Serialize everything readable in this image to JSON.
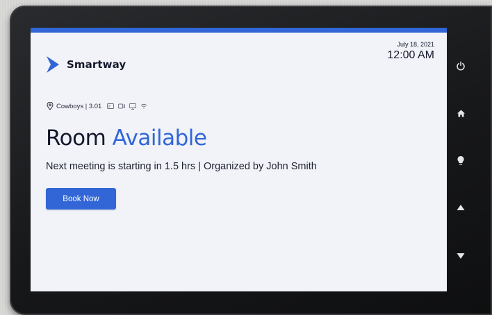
{
  "brand": {
    "name": "Smartway",
    "logo_icon": "chevron-right-icon",
    "accent": "#3266d6"
  },
  "header": {
    "date": "July 18, 2021",
    "time": "12:00 AM"
  },
  "room": {
    "location": "Cowboys | 3.01",
    "location_icon": "map-pin-icon",
    "amenities": [
      "id-card-icon",
      "video-camera-icon",
      "monitor-icon",
      "wifi-icon"
    ],
    "title_prefix": "Room",
    "title_status": "Available",
    "next_meeting": "Next meeting is starting in 1.5 hrs | Organized by John Smith",
    "book_label": "Book Now"
  },
  "device_buttons": [
    "power-icon",
    "home-icon",
    "lightbulb-icon",
    "arrow-up-icon",
    "arrow-down-icon"
  ],
  "colors": {
    "primary": "#3266d6",
    "text": "#14172a",
    "screen_bg": "#f1f3f9",
    "bezel": "#17181a"
  }
}
